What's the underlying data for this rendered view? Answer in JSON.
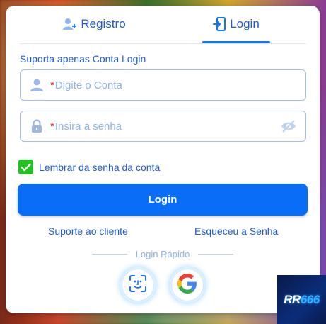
{
  "tabs": [
    {
      "label": "Registro",
      "icon": "user-add-icon"
    },
    {
      "label": "Login",
      "icon": "login-door-icon",
      "active": true
    }
  ],
  "form": {
    "hint": "Suporta apenas Conta Login",
    "required_mark": "*",
    "account_placeholder": "Digite o Conta",
    "password_placeholder": "Insira a senha",
    "remember_label": "Lembrar da senha da conta",
    "remember_checked": true,
    "login_button": "Login"
  },
  "links": {
    "support": "Suporte ao cliente",
    "forgot": "Esqueceu a Senha"
  },
  "quick_login": {
    "label": "Login Rápido",
    "options": [
      {
        "icon": "face-id-icon"
      },
      {
        "icon": "google-icon"
      }
    ]
  },
  "brand": {
    "text_a": "RR",
    "text_b": "666"
  },
  "colors": {
    "primary": "#0a6df5",
    "text_blue": "#1e5bd8",
    "placeholder": "#8db4ee",
    "checkbox": "#21c41f",
    "required": "#e0242a"
  }
}
